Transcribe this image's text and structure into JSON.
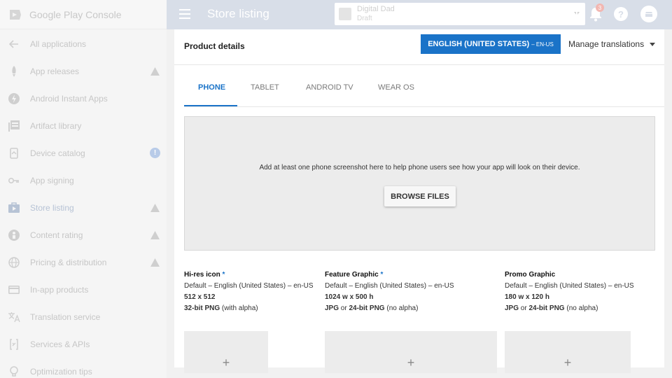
{
  "brand": {
    "name": "Google Play Console"
  },
  "sidebar": {
    "items": [
      {
        "label": "All applications",
        "icon": "arrow-left-icon",
        "warn": false,
        "info": false
      },
      {
        "label": "App releases",
        "icon": "rocket-icon",
        "warn": true,
        "info": false
      },
      {
        "label": "Android Instant Apps",
        "icon": "bolt-icon",
        "warn": false,
        "info": false
      },
      {
        "label": "Artifact library",
        "icon": "library-icon",
        "warn": false,
        "info": false
      },
      {
        "label": "Device catalog",
        "icon": "device-icon",
        "warn": false,
        "info": true
      },
      {
        "label": "App signing",
        "icon": "key-icon",
        "warn": false,
        "info": false
      },
      {
        "label": "Store listing",
        "icon": "store-icon",
        "warn": true,
        "info": false,
        "active": true
      },
      {
        "label": "Content rating",
        "icon": "rating-icon",
        "warn": true,
        "info": false
      },
      {
        "label": "Pricing & distribution",
        "icon": "globe-icon",
        "warn": true,
        "info": false
      },
      {
        "label": "In-app products",
        "icon": "card-icon",
        "warn": false,
        "info": false
      },
      {
        "label": "Translation service",
        "icon": "translate-icon",
        "warn": false,
        "info": false
      },
      {
        "label": "Services & APIs",
        "icon": "api-icon",
        "warn": false,
        "info": false
      },
      {
        "label": "Optimization tips",
        "icon": "lightbulb-icon",
        "warn": false,
        "info": false
      }
    ],
    "info_badge": "!"
  },
  "topbar": {
    "title": "Store listing",
    "app": {
      "name": "Digital Dad",
      "status": "Draft"
    },
    "info_glyph": "i",
    "notification_count": "3",
    "help_glyph": "?"
  },
  "product": {
    "section_title": "Product details",
    "language_button": "ENGLISH (UNITED STATES)",
    "language_code": "– EN-US",
    "manage_translations": "Manage translations",
    "tabs": [
      "PHONE",
      "TABLET",
      "ANDROID TV",
      "WEAR OS"
    ],
    "dropzone_text": "Add at least one phone screenshot here to help phone users see how your app will look on their device.",
    "browse_button": "BROWSE FILES"
  },
  "graphics": [
    {
      "title": "Hi-res icon",
      "required": "*",
      "locale": "Default – English (United States) – en-US",
      "size": "512 x 512",
      "format_a": "32-bit PNG",
      "format_b": " (with alpha)",
      "format_c": "",
      "plus": "+"
    },
    {
      "title": "Feature Graphic",
      "required": "*",
      "locale": "Default – English (United States) – en-US",
      "size": "1024 w x 500 h",
      "format_a": "JPG",
      "format_b": " or ",
      "format_c": "24-bit PNG",
      "format_d": " (no alpha)",
      "plus": "+"
    },
    {
      "title": "Promo Graphic",
      "required": "",
      "locale": "Default – English (United States) – en-US",
      "size": "180 w x 120 h",
      "format_a": "JPG",
      "format_b": " or ",
      "format_c": "24-bit PNG",
      "format_d": " (no alpha)",
      "plus": "+"
    }
  ],
  "colors": {
    "accent": "#1a73c8",
    "topbar": "#d8dee8",
    "sidebar": "#f5f5f5"
  }
}
